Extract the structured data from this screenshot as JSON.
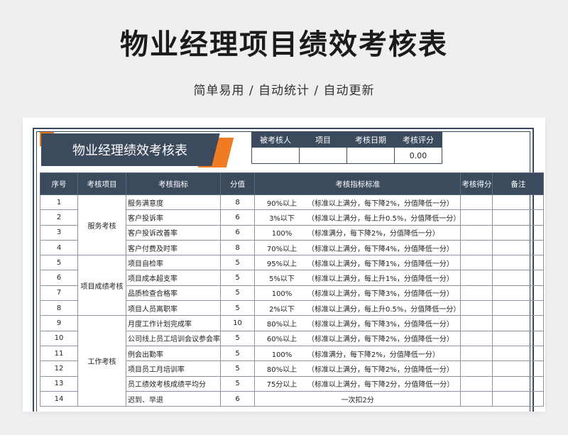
{
  "page": {
    "title": "物业经理项目绩效考核表",
    "subtitle": "简单易用 / 自动统计 / 自动更新"
  },
  "sheet": {
    "banner_title": "物业经理绩效考核表",
    "info_headers": [
      "被考核人",
      "项目",
      "考核日期",
      "考核评分"
    ],
    "info_values": [
      "",
      "",
      "",
      "0.00"
    ],
    "columns": [
      "序号",
      "考核项目",
      "考核指标",
      "分值",
      "考核指标标准",
      "考核得分",
      "备注"
    ],
    "groups": [
      {
        "name": "服务考核",
        "start": 0,
        "span": 4
      },
      {
        "name": "项目成绩考核",
        "start": 4,
        "span": 4
      },
      {
        "name": "工作考核",
        "start": 8,
        "span": 6
      }
    ],
    "rows": [
      {
        "no": "1",
        "indicator": "服务满意度",
        "score": "8",
        "threshold": "90%以上",
        "standard": "（标准以上满分，每下降2%，分值降低一分）"
      },
      {
        "no": "2",
        "indicator": "客户投诉率",
        "score": "6",
        "threshold": "3%以下",
        "standard": "（标准以上满分，每上升0.5%，分值降低一分）"
      },
      {
        "no": "3",
        "indicator": "客户投诉改善率",
        "score": "6",
        "threshold": "100%",
        "standard": "（标准满分，每下降2%，分值降低一分）"
      },
      {
        "no": "4",
        "indicator": "客户付费及时率",
        "score": "8",
        "threshold": "70%以上",
        "standard": "（标准以上满分，每下降4%，分值降低一分）"
      },
      {
        "no": "5",
        "indicator": "项目自检率",
        "score": "5",
        "threshold": "95%以上",
        "standard": "（标准以上满分，每下降1%，分值降低一分）"
      },
      {
        "no": "6",
        "indicator": "项目成本超支率",
        "score": "5",
        "threshold": "5%以下",
        "standard": "（标准以上满分，每上升1%，分值降低一分）"
      },
      {
        "no": "7",
        "indicator": "品质检查合格率",
        "score": "5",
        "threshold": "100%",
        "standard": "（标准以上满分，每下降3%，分值降低一分）"
      },
      {
        "no": "8",
        "indicator": "项目人员离职率",
        "score": "5",
        "threshold": "2%以下",
        "standard": "（标准以上满分，每上升0.5%，分值降低一分）"
      },
      {
        "no": "9",
        "indicator": "月度工作计划完成率",
        "score": "10",
        "threshold": "80%以上",
        "standard": "（标准以上满分，每下降3%，分值降低一分）"
      },
      {
        "no": "10",
        "indicator": "公司线上员工培训会议参会率",
        "score": "5",
        "threshold": "60%以上",
        "standard": "（标准以上满分，每下降2%，分值降低一分）"
      },
      {
        "no": "11",
        "indicator": "例会出勤率",
        "score": "5",
        "threshold": "100%",
        "standard": "（标准满分，每下降2%，分值降低一分）"
      },
      {
        "no": "12",
        "indicator": "项目员工月培训率",
        "score": "5",
        "threshold": "80%以上",
        "standard": "（标准以上满分，每下降2%，分值降低一分）"
      },
      {
        "no": "13",
        "indicator": "员工绩效考核成绩平均分",
        "score": "5",
        "threshold": "75分以上",
        "standard": "（标准以上满分，每下降2分，分值降低一分）"
      },
      {
        "no": "14",
        "indicator": "迟到、早退",
        "score": "6",
        "threshold": "",
        "standard": "一次扣2分",
        "merged": true
      }
    ]
  }
}
